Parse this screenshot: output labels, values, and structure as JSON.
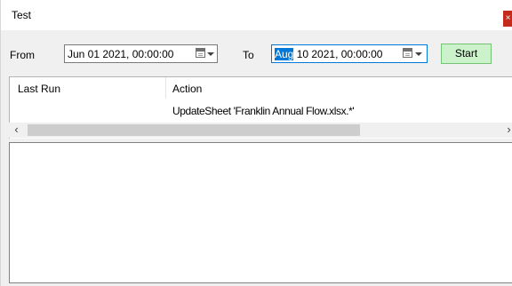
{
  "window": {
    "title": "Test",
    "close_glyph": "×"
  },
  "toolbar": {
    "from_label": "From",
    "from_date": "Jun  01 2021, 00:00:00",
    "to_label": "To",
    "to_date_selected": "Aug",
    "to_date_rest": " 10 2021, 00:00:00",
    "start_label": "Start"
  },
  "list": {
    "columns": [
      "Last Run",
      "Action"
    ],
    "rows": [
      {
        "last_run": "",
        "action": "UpdateSheet 'Franklin Annual Flow.xlsx.*'"
      }
    ]
  },
  "scrollbar": {
    "left_arrow": "‹",
    "right_arrow": "›"
  },
  "colors": {
    "accent": "#0078d7",
    "start_button": "#ccf2cc",
    "close_button": "#c42b1c"
  }
}
